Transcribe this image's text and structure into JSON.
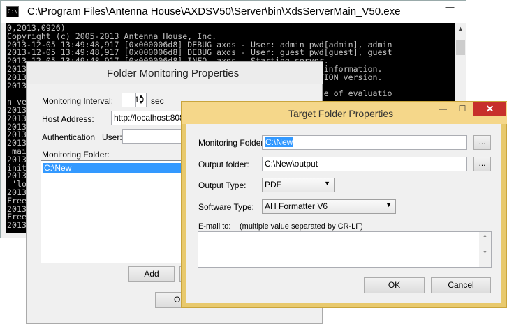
{
  "console": {
    "title": "C:\\Program Files\\Antenna House\\AXDSV50\\Server\\bin\\XdsServerMain_V50.exe",
    "icon": "terminal-icon",
    "minimize_glyph": "—",
    "lines": [
      "0,2013,0926)",
      "Copyright (c) 2005-2013 Antenna House, Inc.",
      "2013-12-05 13:49:48,917 [0x000006d8] DEBUG axds - User: admin pwd[admin], admin",
      "2013-12-05 13:49:48,917 [0x000006d8] DEBUG axds - User: guest pwd[guest], guest",
      "2013-12-05 13:49:48,917 [0x000006d8] INFO  axds - Starting server.",
      "2013-                                                  g license information.",
      "2013-                                                  an EVALUATION version.",
      "2013",
      "                                                       its the use of evaluatio",
      "n ve",
      "2013",
      "2013",
      "2013",
      "2013",
      "2013",
      " mai",
      "2013",
      "init",
      "2013",
      " 'lo",
      "2013",
      "Free",
      "2013",
      "Free",
      "2013"
    ]
  },
  "folder_dialog": {
    "title": "Folder Monitoring Properties",
    "monitoring_interval_label": "Monitoring Interval:",
    "monitoring_interval_value": "10",
    "interval_unit": "sec",
    "host_address_label": "Host Address:",
    "host_address_value": "http://localhost:8088",
    "authentication_label": "Authentication",
    "user_label": "User:",
    "monitoring_folder_label": "Monitoring Folder:",
    "folders": [
      "C:\\New"
    ],
    "add_button": "Add",
    "ok_button": "OK"
  },
  "target_dialog": {
    "title": "Target Folder Properties",
    "minimize_glyph": "—",
    "maximize_glyph": "☐",
    "close_glyph": "✕",
    "monitoring_folder_label": "Monitoring Folder:",
    "monitoring_folder_value": "C:\\New",
    "output_folder_label": "Output folder:",
    "output_folder_value": "C:\\New\\output",
    "browse_label": "...",
    "output_type_label": "Output Type:",
    "output_type_value": "PDF",
    "software_type_label": "Software Type:",
    "software_type_value": "AH Formatter V6",
    "email_label": "E-mail to:",
    "email_hint": "(multiple value separated by CR-LF)",
    "ok_button": "OK",
    "cancel_button": "Cancel"
  }
}
